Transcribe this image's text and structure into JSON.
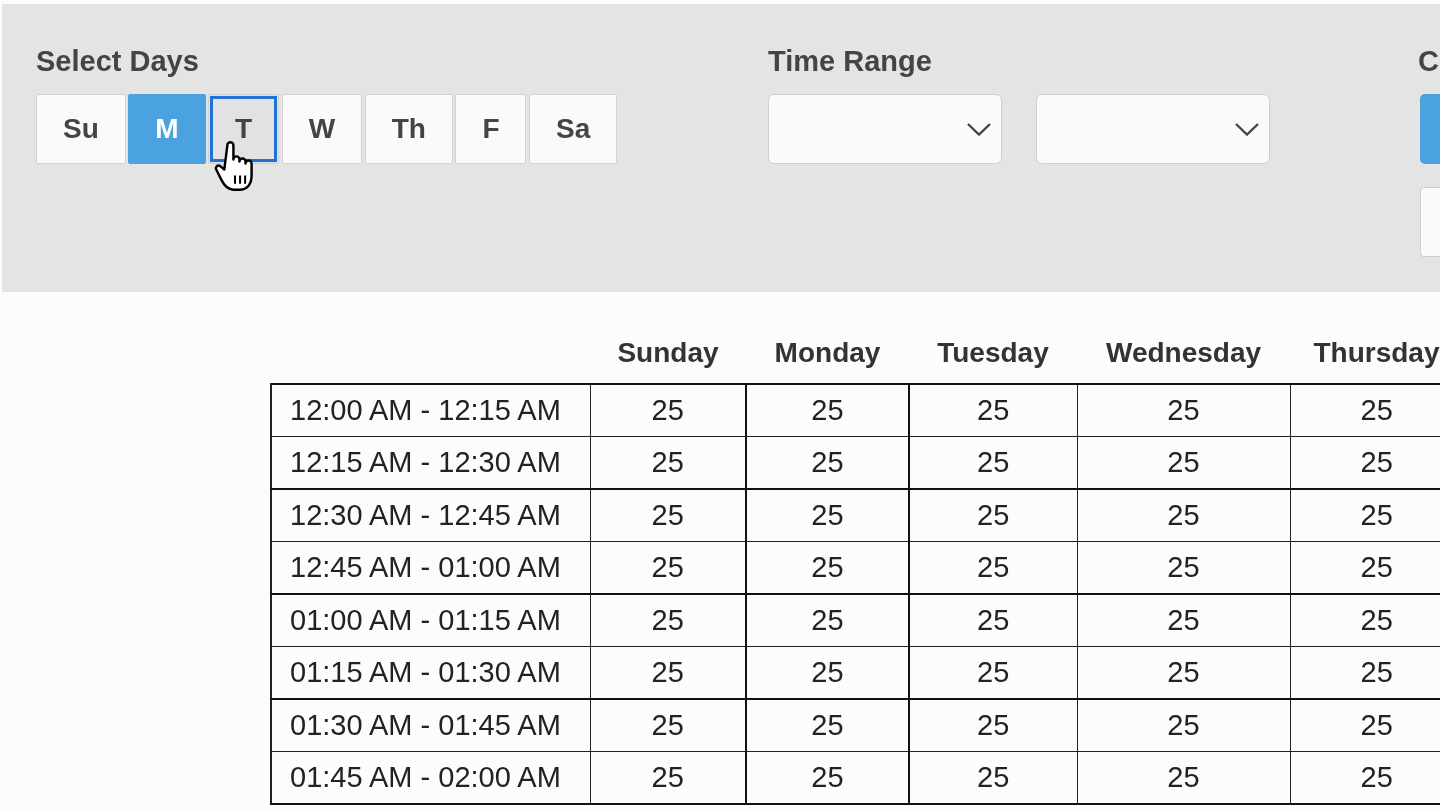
{
  "filters": {
    "day_picker": {
      "label": "Select Days",
      "days": [
        {
          "label": "Su",
          "selected": false,
          "focused": false
        },
        {
          "label": "M",
          "selected": true,
          "focused": false
        },
        {
          "label": "T",
          "selected": false,
          "focused": true
        },
        {
          "label": "W",
          "selected": false,
          "focused": false
        },
        {
          "label": "Th",
          "selected": false,
          "focused": false
        },
        {
          "label": "F",
          "selected": false,
          "focused": false
        },
        {
          "label": "Sa",
          "selected": false,
          "focused": false
        }
      ]
    },
    "time_range": {
      "label": "Time Range",
      "dropdowns": [
        {
          "expanded": false
        },
        {
          "expanded": false
        }
      ]
    },
    "filter_group_3": {
      "label": "C"
    }
  },
  "table": {
    "columns": [
      "Sunday",
      "Monday",
      "Tuesday",
      "Wednesday",
      "Thursday"
    ],
    "rows": [
      {
        "time": "12:00 AM - 12:15 AM",
        "values": [
          "25",
          "25",
          "25",
          "25",
          "25"
        ]
      },
      {
        "time": "12:15 AM - 12:30 AM",
        "values": [
          "25",
          "25",
          "25",
          "25",
          "25"
        ]
      },
      {
        "time": "12:30 AM - 12:45 AM",
        "values": [
          "25",
          "25",
          "25",
          "25",
          "25"
        ]
      },
      {
        "time": "12:45 AM - 01:00 AM",
        "values": [
          "25",
          "25",
          "25",
          "25",
          "25"
        ]
      },
      {
        "time": "01:00 AM - 01:15 AM",
        "values": [
          "25",
          "25",
          "25",
          "25",
          "25"
        ]
      },
      {
        "time": "01:15 AM - 01:30 AM",
        "values": [
          "25",
          "25",
          "25",
          "25",
          "25"
        ]
      },
      {
        "time": "01:30 AM - 01:45 AM",
        "values": [
          "25",
          "25",
          "25",
          "25",
          "25"
        ]
      },
      {
        "time": "01:45 AM - 02:00 AM",
        "values": [
          "25",
          "25",
          "25",
          "25",
          "25"
        ]
      }
    ]
  }
}
